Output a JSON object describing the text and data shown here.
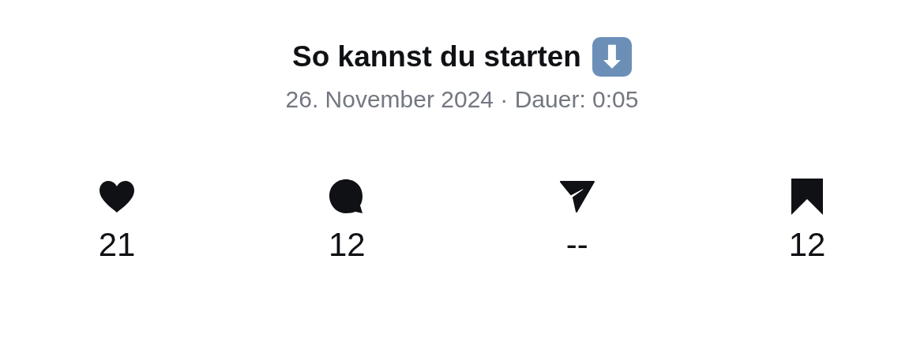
{
  "title": {
    "text": "So kannst du starten",
    "emoji": "⬇"
  },
  "subtitle": "26. November 2024 · Dauer: 0:05",
  "stats": [
    {
      "kind": "likes",
      "value": "21"
    },
    {
      "kind": "comments",
      "value": "12"
    },
    {
      "kind": "shares",
      "value": "--"
    },
    {
      "kind": "saves",
      "value": "12"
    }
  ]
}
